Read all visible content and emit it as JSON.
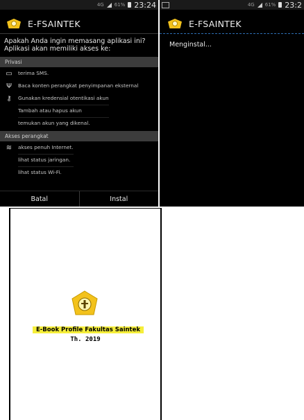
{
  "left_screen": {
    "status": {
      "time": "23:24",
      "battery": "61%",
      "network": "4G"
    },
    "app_title": "E-FSAINTEK",
    "prompt": "Apakah Anda ingin memasang aplikasi ini? Aplikasi akan memiliki akses ke:",
    "sections": [
      {
        "header": "Privasi",
        "groups": [
          {
            "icon": "sms-icon",
            "glyph": "▭",
            "lines": [
              "terima SMS."
            ]
          },
          {
            "icon": "usb-icon",
            "glyph": "Ψ",
            "lines": [
              "Baca konten perangkat penyimpanan eksternal"
            ]
          },
          {
            "icon": "key-icon",
            "glyph": "⚷",
            "lines": [
              "Gunakan kredensial otentikasi akun",
              "Tambah atau hapus akun",
              "temukan akun yang dikenal."
            ]
          }
        ]
      },
      {
        "header": "Akses perangkat",
        "groups": [
          {
            "icon": "wifi-icon",
            "glyph": "≋",
            "lines": [
              "akses penuh Internet.",
              "lihat status jaringan.",
              "lihat status Wi-Fi."
            ]
          }
        ]
      }
    ],
    "buttons": {
      "cancel": "Batal",
      "install": "Instal"
    }
  },
  "right_screen": {
    "status": {
      "time": "23:2",
      "battery": "61%",
      "network": "4G"
    },
    "app_title": "E-FSAINTEK",
    "status_text": "Menginstal..."
  },
  "document": {
    "title": "E-Book Profile Fakultas Saintek",
    "year": "Th. 2019"
  },
  "colors": {
    "accent": "#2d6fb5",
    "logo": "#f3c21c",
    "highlight": "#f5ee3a"
  }
}
